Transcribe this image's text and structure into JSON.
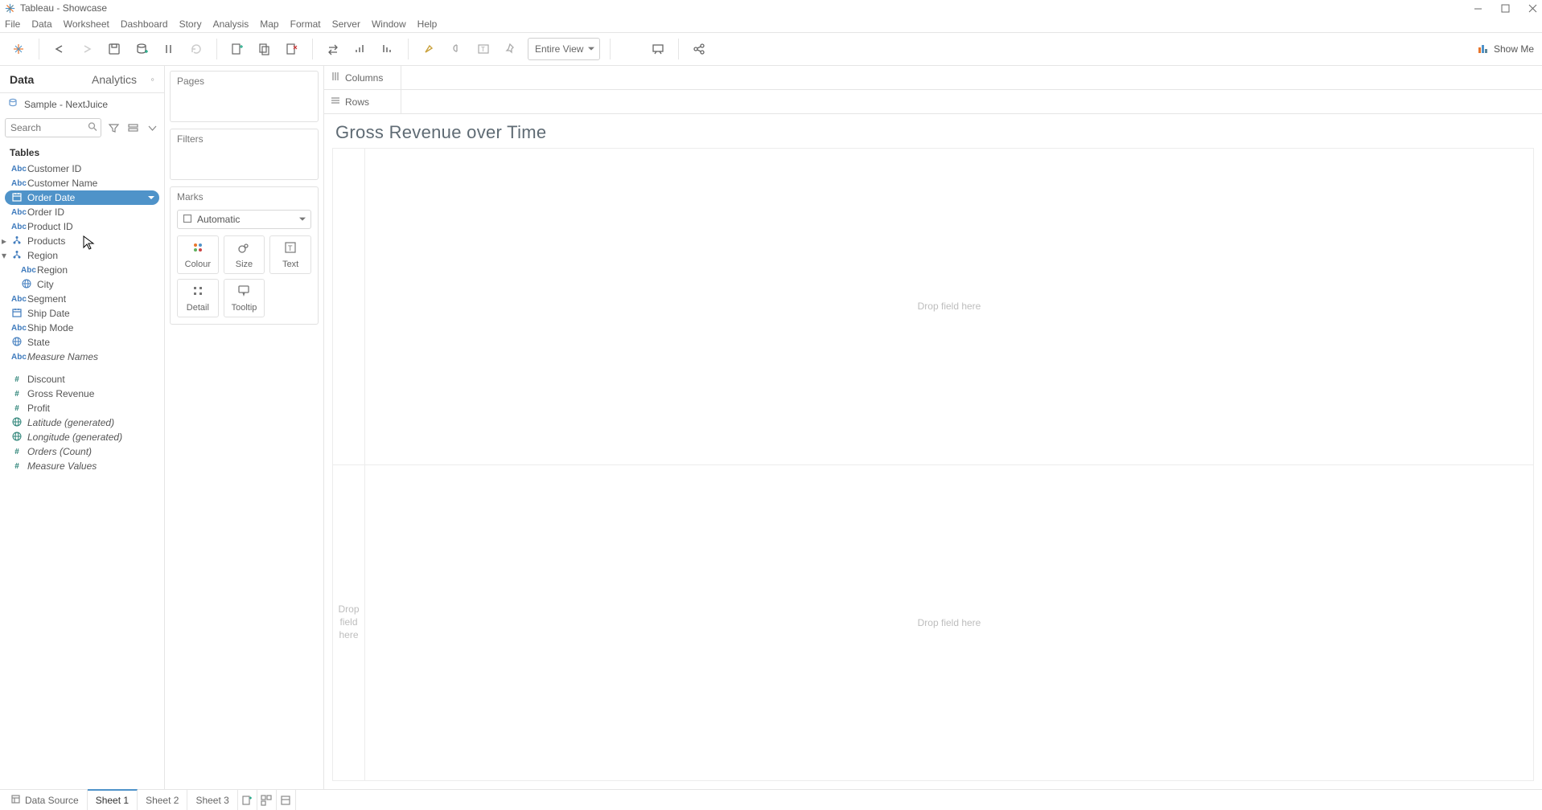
{
  "window_title": "Tableau - Showcase",
  "menu": [
    "File",
    "Data",
    "Worksheet",
    "Dashboard",
    "Story",
    "Analysis",
    "Map",
    "Format",
    "Server",
    "Window",
    "Help"
  ],
  "toolbar": {
    "view_mode": "Entire View",
    "showme": "Show Me"
  },
  "leftpane": {
    "tabs": {
      "data": "Data",
      "analytics": "Analytics"
    },
    "datasource": "Sample - NextJuice",
    "search_placeholder": "Search",
    "tables_hdr": "Tables"
  },
  "fields": {
    "dims": [
      {
        "name": "Customer ID",
        "icon": "Abc"
      },
      {
        "name": "Customer Name",
        "icon": "Abc"
      },
      {
        "name": "Order Date",
        "icon": "cal",
        "selected": true
      },
      {
        "name": "Order ID",
        "icon": "Abc"
      },
      {
        "name": "Product ID",
        "icon": "Abc"
      },
      {
        "name": "Products",
        "icon": "hier",
        "expandable": true
      },
      {
        "name": "Region",
        "icon": "hier",
        "expanded": true
      },
      {
        "name": "Region",
        "icon": "Abc",
        "child": true
      },
      {
        "name": "City",
        "icon": "globe",
        "child": true
      },
      {
        "name": "Segment",
        "icon": "Abc"
      },
      {
        "name": "Ship Date",
        "icon": "cal"
      },
      {
        "name": "Ship Mode",
        "icon": "Abc"
      },
      {
        "name": "State",
        "icon": "globe"
      },
      {
        "name": "Measure Names",
        "icon": "Abc",
        "italic": true
      }
    ],
    "meas": [
      {
        "name": "Discount",
        "icon": "#"
      },
      {
        "name": "Gross Revenue",
        "icon": "#"
      },
      {
        "name": "Profit",
        "icon": "#"
      },
      {
        "name": "Latitude (generated)",
        "icon": "globe",
        "italic": true
      },
      {
        "name": "Longitude (generated)",
        "icon": "globe",
        "italic": true
      },
      {
        "name": "Orders (Count)",
        "icon": "#",
        "italic": true
      },
      {
        "name": "Measure Values",
        "icon": "#",
        "italic": true
      }
    ]
  },
  "shelves": {
    "pages": "Pages",
    "filters": "Filters",
    "marks": "Marks",
    "columns": "Columns",
    "rows": "Rows"
  },
  "marks": {
    "type": "Automatic",
    "cells": [
      "Colour",
      "Size",
      "Text",
      "Detail",
      "Tooltip"
    ]
  },
  "vis": {
    "title": "Gross Revenue over Time",
    "drop_here": "Drop field here",
    "drop_here_row": "Drop\nfield\nhere"
  },
  "sheets": {
    "datasource": "Data Source",
    "tabs": [
      "Sheet 1",
      "Sheet 2",
      "Sheet 3"
    ]
  }
}
